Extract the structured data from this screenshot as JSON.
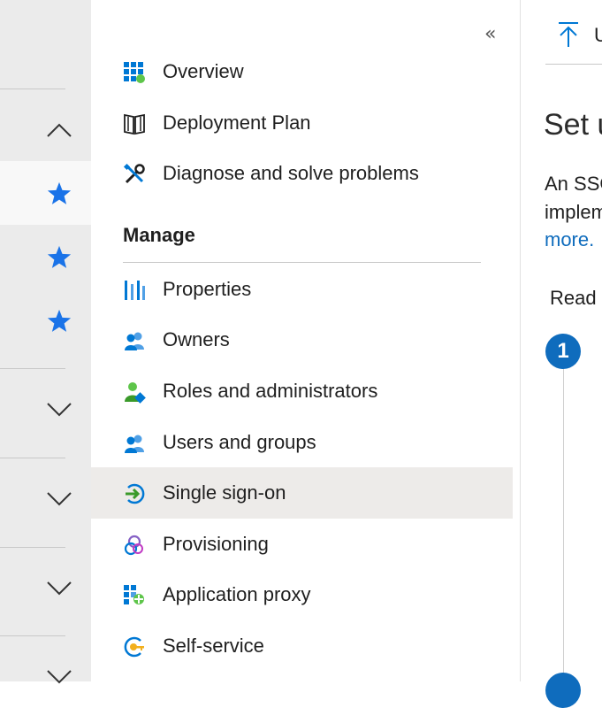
{
  "menu": {
    "collapse_glyph": "«",
    "top_items": [
      {
        "label": "Overview",
        "icon": "overview-grid-icon"
      },
      {
        "label": "Deployment Plan",
        "icon": "book-icon"
      },
      {
        "label": "Diagnose and solve problems",
        "icon": "wrench-screwdriver-icon"
      }
    ],
    "section_title": "Manage",
    "manage_items": [
      {
        "label": "Properties",
        "icon": "properties-bars-icon"
      },
      {
        "label": "Owners",
        "icon": "people-icon"
      },
      {
        "label": "Roles and administrators",
        "icon": "admin-person-icon"
      },
      {
        "label": "Users and groups",
        "icon": "people-icon"
      },
      {
        "label": "Single sign-on",
        "icon": "sign-in-arrow-icon",
        "active": true
      },
      {
        "label": "Provisioning",
        "icon": "provisioning-cycle-icon"
      },
      {
        "label": "Application proxy",
        "icon": "app-proxy-grid-icon"
      },
      {
        "label": "Self-service",
        "icon": "self-service-key-icon"
      }
    ]
  },
  "main": {
    "command_label": "U",
    "title": "Set u",
    "desc_line1": "An SSO",
    "desc_line2": "implem",
    "more_link": "more.",
    "read_text": "Read t",
    "step_number": "1"
  },
  "colors": {
    "accent": "#0f6cbd",
    "star": "#1a73e8",
    "active_bg": "#edebe9",
    "rail_bg": "#ebebeb"
  }
}
